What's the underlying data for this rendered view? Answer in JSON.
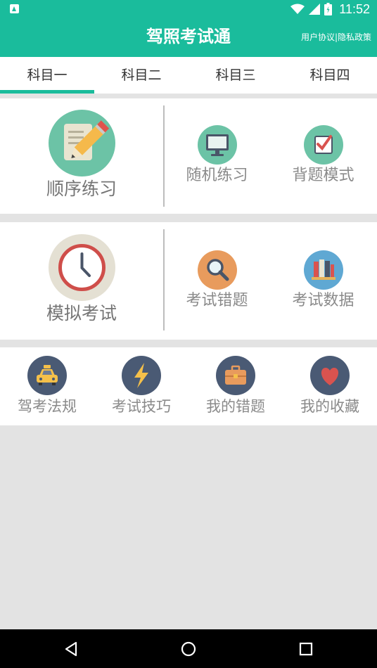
{
  "status_bar": {
    "time": "11:52",
    "icons": [
      "app-notification-icon",
      "wifi-icon",
      "signal-icon",
      "battery-icon"
    ]
  },
  "header": {
    "title": "驾照考试通",
    "policy_links": "用户协议|隐私政策"
  },
  "tabs": [
    {
      "label": "科目一",
      "selected": true
    },
    {
      "label": "科目二",
      "selected": false
    },
    {
      "label": "科目三",
      "selected": false
    },
    {
      "label": "科目四",
      "selected": false
    }
  ],
  "practice": {
    "primary": {
      "label": "顺序练习",
      "icon": "pencil-notepad-icon"
    },
    "random": {
      "label": "随机练习",
      "icon": "monitor-icon"
    },
    "memorize": {
      "label": "背题模式",
      "icon": "checkbox-icon"
    }
  },
  "exam": {
    "primary": {
      "label": "模拟考试",
      "icon": "clock-icon"
    },
    "errors": {
      "label": "考试错题",
      "icon": "magnifier-icon"
    },
    "stats": {
      "label": "考试数据",
      "icon": "books-icon"
    }
  },
  "tools": [
    {
      "label": "驾考法规",
      "icon": "taxi-icon"
    },
    {
      "label": "考试技巧",
      "icon": "lightning-icon"
    },
    {
      "label": "我的错题",
      "icon": "briefcase-icon"
    },
    {
      "label": "我的收藏",
      "icon": "heart-icon"
    }
  ],
  "nav_bar": {
    "buttons": [
      "back-icon",
      "home-icon",
      "recents-icon"
    ]
  },
  "colors": {
    "accent": "#1abc9c",
    "tool_circle": "#4a5a74",
    "background": "#e3e3e3"
  }
}
